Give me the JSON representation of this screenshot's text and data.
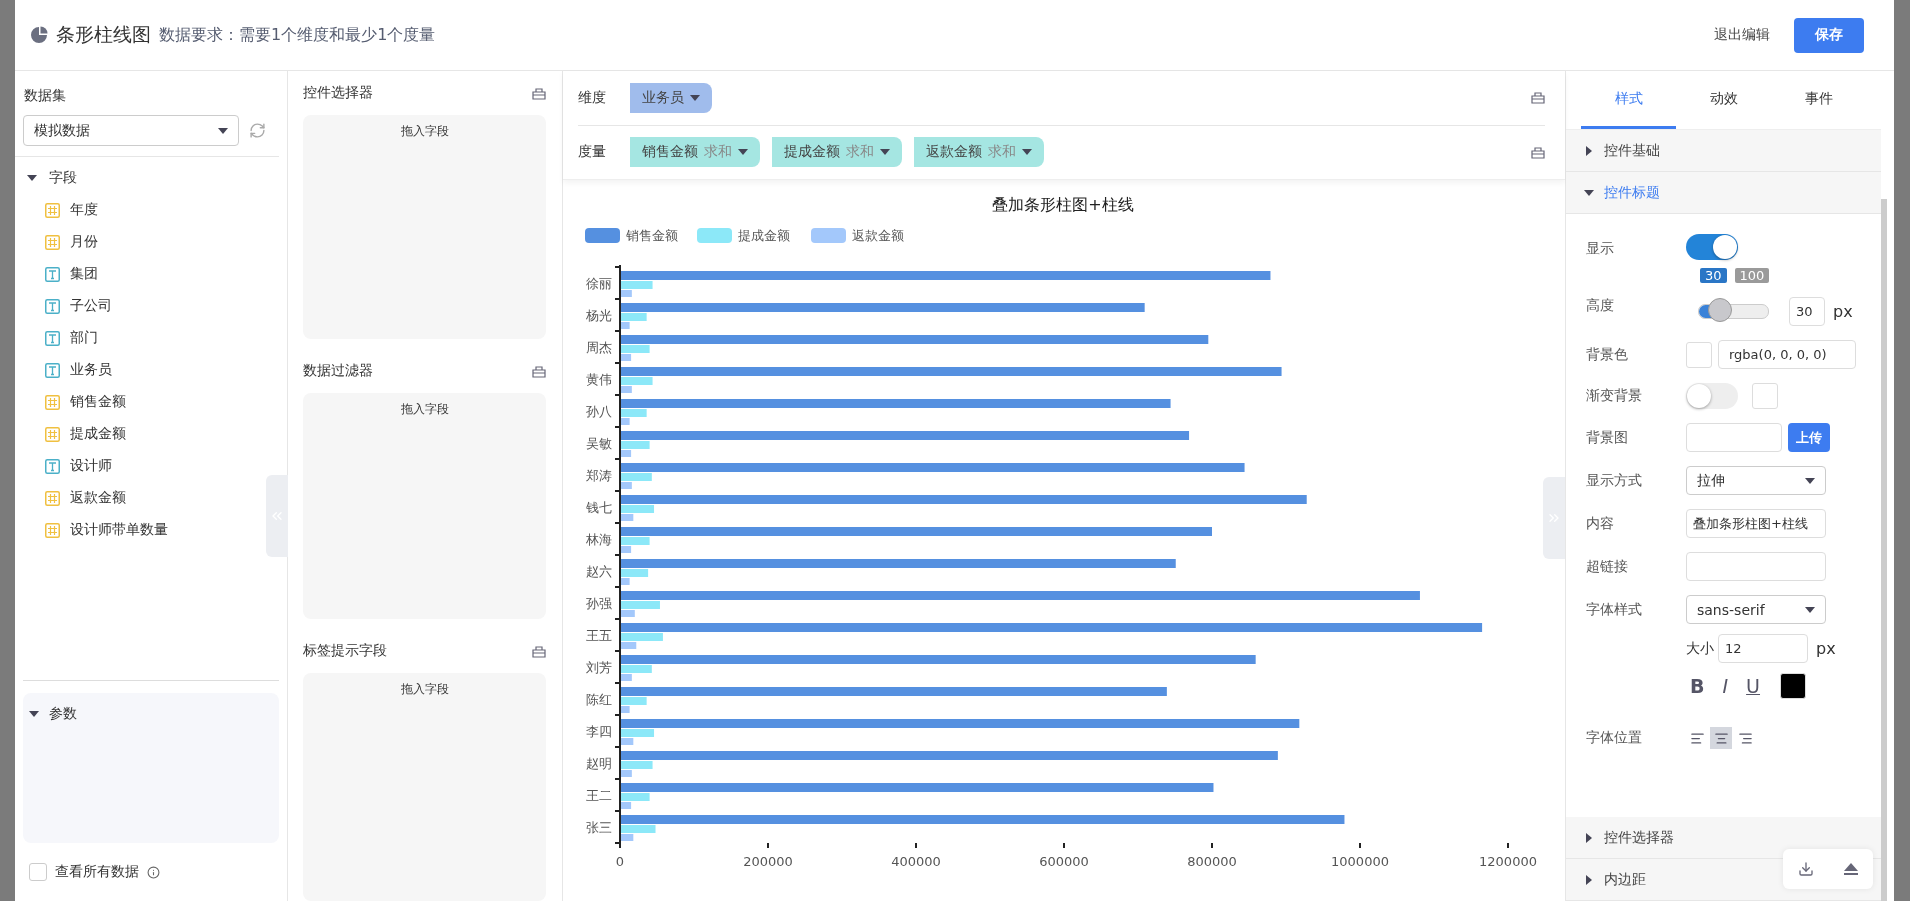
{
  "header": {
    "title": "条形柱线图",
    "requirement": "数据要求：需要1个维度和最少1个度量",
    "exit": "退出编辑",
    "save": "保存"
  },
  "dataset": {
    "label": "数据集",
    "value": "模拟数据"
  },
  "fields": {
    "label": "字段",
    "expanded": true,
    "items": [
      {
        "name": "年度",
        "kind": "number"
      },
      {
        "name": "月份",
        "kind": "number"
      },
      {
        "name": "集团",
        "kind": "text"
      },
      {
        "name": "子公司",
        "kind": "text"
      },
      {
        "name": "部门",
        "kind": "text"
      },
      {
        "name": "业务员",
        "kind": "text"
      },
      {
        "name": "销售金额",
        "kind": "number"
      },
      {
        "name": "提成金额",
        "kind": "number"
      },
      {
        "name": "设计师",
        "kind": "text"
      },
      {
        "name": "返款金额",
        "kind": "number"
      },
      {
        "name": "设计师带单数量",
        "kind": "number"
      }
    ]
  },
  "params": {
    "label": "参数",
    "expanded": true
  },
  "view_all": {
    "label": "查看所有数据",
    "checked": false
  },
  "drop_zones": [
    {
      "title": "控件选择器",
      "hint": "拖入字段"
    },
    {
      "title": "数据过滤器",
      "hint": "拖入字段"
    },
    {
      "title": "标签提示字段",
      "hint": "拖入字段"
    }
  ],
  "dimension": {
    "label": "维度",
    "pills": [
      {
        "name": "业务员"
      }
    ]
  },
  "measure": {
    "label": "度量",
    "pills": [
      {
        "name": "销售金额",
        "agg": "求和"
      },
      {
        "name": "提成金额",
        "agg": "求和"
      },
      {
        "name": "返款金额",
        "agg": "求和"
      }
    ]
  },
  "chart": {
    "chart_data": {
      "type": "bar",
      "title": "叠加条形柱图+柱线",
      "orientation": "horizontal",
      "categories": [
        "徐丽",
        "杨光",
        "周杰",
        "黄伟",
        "孙八",
        "吴敏",
        "郑涛",
        "钱七",
        "林海",
        "赵六",
        "孙强",
        "王五",
        "刘芳",
        "陈红",
        "李四",
        "赵明",
        "王二",
        "张三"
      ],
      "series": [
        {
          "name": "销售金额",
          "color": "#5590e0",
          "values": [
            879000,
            709000,
            795000,
            894000,
            744000,
            769000,
            844000,
            928000,
            800000,
            751000,
            1081000,
            1165000,
            859000,
            739000,
            918000,
            889000,
            802000,
            979000
          ]
        },
        {
          "name": "提成金额",
          "color": "#8ce8f8",
          "values": [
            44000,
            36000,
            40000,
            44000,
            36000,
            40000,
            43000,
            46000,
            40000,
            38000,
            54000,
            58000,
            43000,
            36000,
            46000,
            44000,
            40000,
            48000
          ]
        },
        {
          "name": "返款金额",
          "color": "#a3c8fb",
          "values": [
            16000,
            13000,
            15000,
            16000,
            13000,
            15000,
            16000,
            18000,
            15000,
            13000,
            20000,
            22000,
            16000,
            13000,
            18000,
            16000,
            15000,
            18000
          ]
        }
      ],
      "legend": "top-left",
      "xlim": [
        0,
        1200000
      ],
      "xticks": [
        0,
        200000,
        400000,
        600000,
        800000,
        1000000,
        1200000
      ]
    }
  },
  "settings": {
    "tabs": [
      {
        "label": "样式",
        "selected": true
      },
      {
        "label": "动效",
        "selected": false
      },
      {
        "label": "事件",
        "selected": false
      }
    ],
    "sections_top": [
      {
        "title": "控件基础",
        "expanded": false
      },
      {
        "title": "控件标题",
        "expanded": true
      }
    ],
    "show": {
      "label": "显示",
      "on": true
    },
    "height": {
      "label": "高度",
      "level": 0.3,
      "min_tag": "30",
      "max_tag": "100",
      "value": "30",
      "unit": "px"
    },
    "bg_color": {
      "label": "背景色",
      "value": "rgba(0, 0, 0, 0)"
    },
    "gradient": {
      "label": "渐变背景",
      "on": false
    },
    "bg_image": {
      "label": "背景图",
      "button": "上传"
    },
    "display_mode": {
      "label": "显示方式",
      "value": "拉伸"
    },
    "content": {
      "label": "内容",
      "value": "叠加条形柱图+柱线"
    },
    "link": {
      "label": "超链接"
    },
    "font_family": {
      "label": "字体样式",
      "value": "sans-serif"
    },
    "font_size": {
      "label": "大小",
      "value": "12",
      "unit": "px"
    },
    "styles": [
      {
        "label": "B",
        "kind": "bold",
        "selected": false
      },
      {
        "label": "I",
        "kind": "italic",
        "selected": false
      },
      {
        "label": "U",
        "kind": "underline",
        "selected": false
      }
    ],
    "font_color": {
      "color": "#000000"
    },
    "align": {
      "label": "字体位置",
      "options": [
        {
          "kind": "left",
          "selected": false
        },
        {
          "kind": "center",
          "selected": true
        },
        {
          "kind": "right",
          "selected": false
        }
      ]
    },
    "sections_bottom": [
      {
        "title": "控件选择器",
        "expanded": false
      },
      {
        "title": "内边距",
        "expanded": false
      }
    ]
  }
}
